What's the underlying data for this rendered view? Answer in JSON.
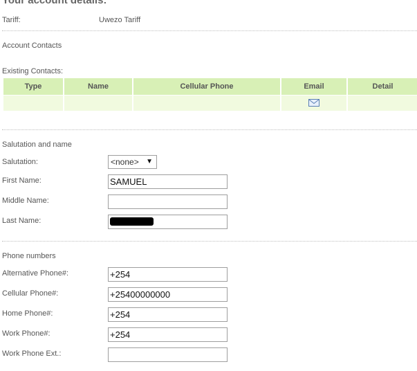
{
  "header": {
    "title": "Your account details:"
  },
  "tariff": {
    "label": "Tariff:",
    "value": "Uwezo Tariff"
  },
  "account_contacts": {
    "title": "Account Contacts"
  },
  "existing_contacts": {
    "label": "Existing Contacts:",
    "columns": [
      "Type",
      "Name",
      "Cellular Phone",
      "Email",
      "Detail"
    ],
    "email_icon": "envelope-icon"
  },
  "salutation_section": {
    "title": "Salutation and name",
    "salutation": {
      "label": "Salutation:",
      "value": "<none>"
    },
    "first_name": {
      "label": "First Name:",
      "value": "SAMUEL"
    },
    "middle_name": {
      "label": "Middle Name:",
      "value": ""
    },
    "last_name": {
      "label": "Last Name:",
      "value": ""
    }
  },
  "phone_section": {
    "title": "Phone numbers",
    "alternative": {
      "label": "Alternative Phone#:",
      "value": "+254"
    },
    "cellular": {
      "label": "Cellular Phone#:",
      "value": "+25400000000"
    },
    "home": {
      "label": "Home Phone#:",
      "value": "+254"
    },
    "work": {
      "label": "Work Phone#:",
      "value": "+254"
    },
    "work_ext": {
      "label": "Work Phone Ext.:",
      "value": ""
    }
  },
  "colors": {
    "table_header": "#d8f0b6",
    "table_row": "#f1fadf",
    "text": "#555555"
  }
}
